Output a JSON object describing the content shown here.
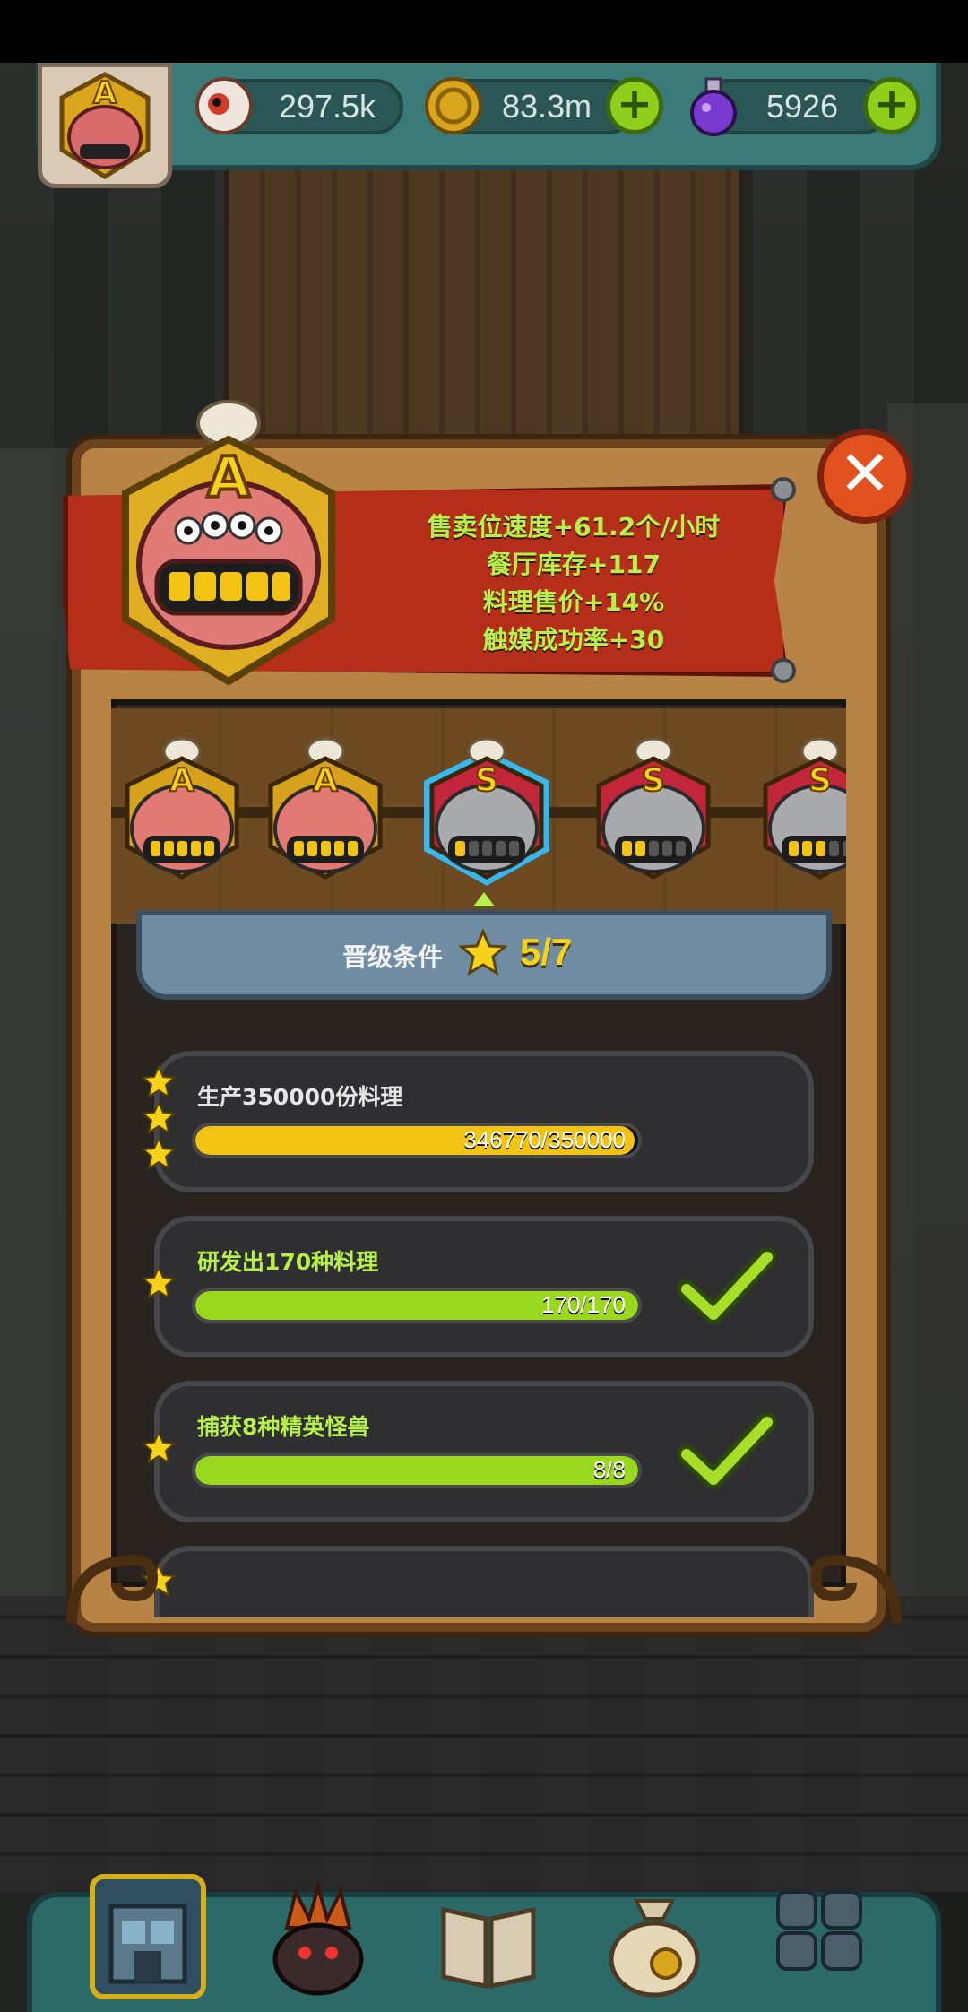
{
  "resources": {
    "eyes": "297.5k",
    "coins": "83.3m",
    "potions": "5926"
  },
  "grade": {
    "current": "A"
  },
  "bonuses": [
    "售卖位速度+61.2个/小时",
    "餐厅库存+117",
    "料理售价+14%",
    "触媒成功率+30"
  ],
  "carousel": {
    "badges": [
      {
        "grade": "A",
        "style": "gold",
        "filled": 5
      },
      {
        "grade": "A",
        "style": "gold",
        "filled": 5
      },
      {
        "grade": "S",
        "style": "silver-selected",
        "filled": 1
      },
      {
        "grade": "S",
        "style": "silver",
        "filled": 2
      },
      {
        "grade": "S",
        "style": "silver",
        "filled": 3
      }
    ]
  },
  "requirements": {
    "label": "晋级条件",
    "progress": "5/7"
  },
  "tasks": [
    {
      "title": "生产350000份料理",
      "progress_text": "346770/350000",
      "progress": 0.991,
      "stars": 3,
      "done": false,
      "color": "#f3c314"
    },
    {
      "title": "研发出170种料理",
      "progress_text": "170/170",
      "progress": 1.0,
      "stars": 1,
      "done": true,
      "color": "#9ad81f"
    },
    {
      "title": "捕获8种精英怪兽",
      "progress_text": "8/8",
      "progress": 1.0,
      "stars": 1,
      "done": true,
      "color": "#9ad81f"
    }
  ],
  "colors": {
    "accent_green": "#b8f04a",
    "gold": "#f3c314",
    "banner_red": "#b52e19"
  },
  "icons": {
    "close": "close-icon",
    "plus": "plus-icon",
    "check": "checkmark-icon",
    "star": "star-icon"
  }
}
